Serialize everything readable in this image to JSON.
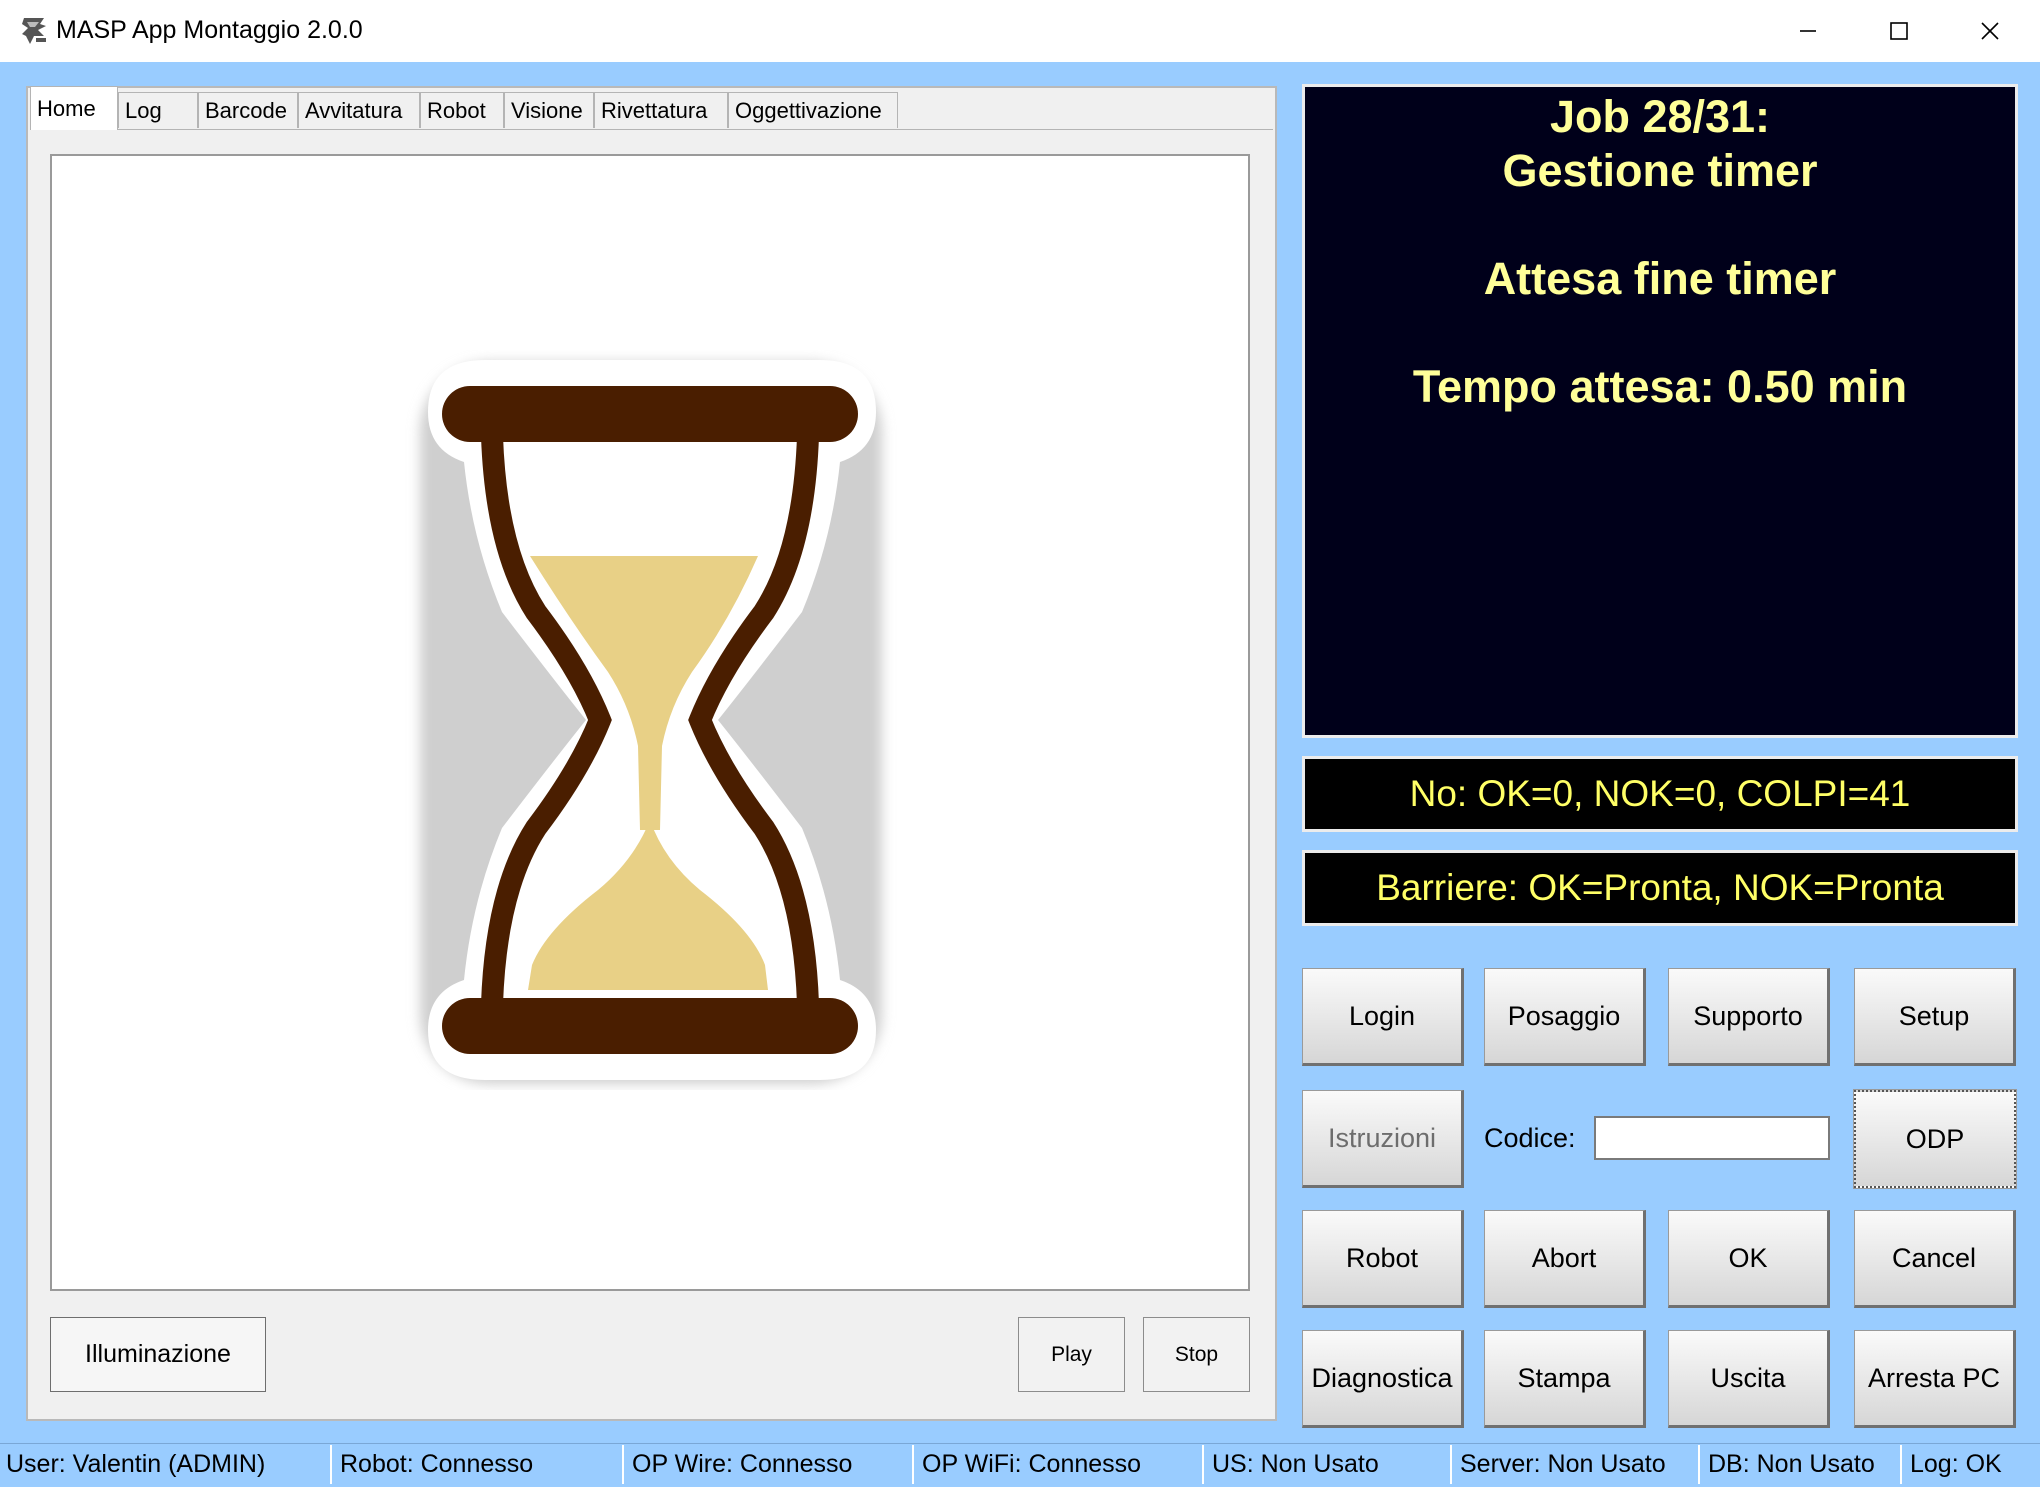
{
  "window": {
    "title": "MASP App Montaggio 2.0.0"
  },
  "tabs": [
    "Home",
    "Log",
    "Barcode",
    "Avvitatura",
    "Robot",
    "Visione",
    "Rivettatura",
    "Oggettivazione"
  ],
  "image_panel": {
    "image": "hourglass-icon"
  },
  "left_buttons": {
    "illuminazione": "Illuminazione",
    "play": "Play",
    "stop": "Stop"
  },
  "job_display": {
    "line1": "Job 28/31:",
    "line2": "Gestione timer",
    "line3": "Attesa fine timer",
    "line4": "Tempo attesa: 0.50 min"
  },
  "counter_display": "No: OK=0, NOK=0, COLPI=41",
  "barrier_display": "Barriere: OK=Pronta, NOK=Pronta",
  "buttons": {
    "login": "Login",
    "posaggio": "Posaggio",
    "supporto": "Supporto",
    "setup": "Setup",
    "istruzioni": "Istruzioni",
    "odp": "ODP",
    "robot": "Robot",
    "abort": "Abort",
    "ok": "OK",
    "cancel": "Cancel",
    "diagnostica": "Diagnostica",
    "stampa": "Stampa",
    "uscita": "Uscita",
    "arresta_pc": "Arresta PC"
  },
  "codice": {
    "label": "Codice:",
    "value": ""
  },
  "statusbar": [
    "User: Valentin (ADMIN)",
    "Robot: Connesso",
    "OP Wire: Connesso",
    "OP WiFi: Connesso",
    "US: Non Usato",
    "Server: Non Usato",
    "DB: Non Usato",
    "Log: OK"
  ],
  "colors": {
    "client_bg": "#99CCFF",
    "display_bg": "#00001A",
    "display_text": "#FFFF99",
    "status_display_bg": "#000000",
    "status_display_text": "#FFFF66",
    "hourglass_frame": "#4A1E00",
    "hourglass_sand": "#E8D086"
  }
}
